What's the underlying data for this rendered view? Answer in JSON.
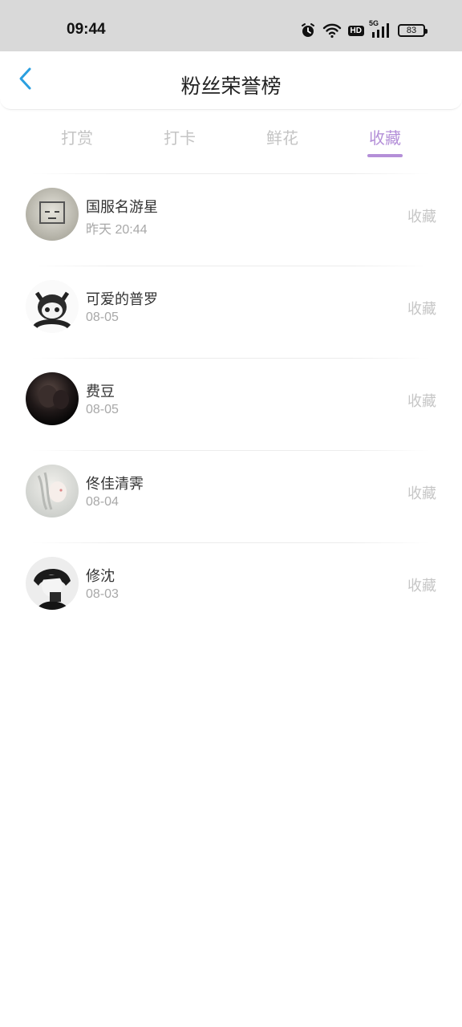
{
  "status_bar": {
    "time": "09:44",
    "battery": "83",
    "network": "5G",
    "hd": "HD"
  },
  "header": {
    "title": "粉丝荣誉榜"
  },
  "tabs": [
    {
      "label": "打赏",
      "active": false
    },
    {
      "label": "打卡",
      "active": false
    },
    {
      "label": "鲜花",
      "active": false
    },
    {
      "label": "收藏",
      "active": true
    }
  ],
  "colors": {
    "accent": "#b48fd8",
    "back": "#2a9fe0",
    "inactive": "#c4c4c4"
  },
  "items": [
    {
      "name": "国服名游星",
      "time": "昨天 20:44",
      "action": "收藏"
    },
    {
      "name": "可爱的普罗",
      "time": "08-05",
      "action": "收藏"
    },
    {
      "name": "费豆",
      "time": "08-05",
      "action": "收藏"
    },
    {
      "name": "佟佳清霁",
      "time": "08-04",
      "action": "收藏"
    },
    {
      "name": "修沈",
      "time": "08-03",
      "action": "收藏"
    }
  ]
}
